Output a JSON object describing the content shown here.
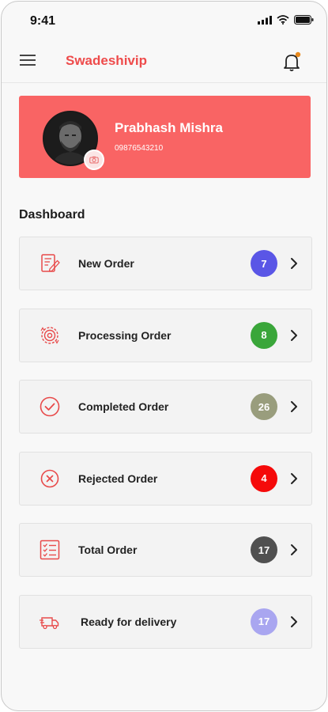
{
  "status_bar": {
    "time": "9:41"
  },
  "header": {
    "title": "Swadeshivip",
    "menu_icon": "hamburger-icon",
    "notification_icon": "bell-icon",
    "accent_color": "#ee4b4b"
  },
  "profile": {
    "name": "Prabhash Mishra",
    "phone": "09876543210",
    "card_color": "#f96464"
  },
  "dashboard": {
    "title": "Dashboard",
    "items": [
      {
        "label": "New Order",
        "count": "7",
        "badge_color": "#5a56e6",
        "icon": "edit-document-icon"
      },
      {
        "label": "Processing Order",
        "count": "8",
        "badge_color": "#3aa63a",
        "icon": "processing-gear-icon"
      },
      {
        "label": "Completed Order",
        "count": "26",
        "badge_color": "#999d7d",
        "icon": "check-circle-icon"
      },
      {
        "label": "Rejected Order",
        "count": "4",
        "badge_color": "#f50a0a",
        "icon": "x-circle-icon"
      },
      {
        "label": "Total Order",
        "count": "17",
        "badge_color": "#505050",
        "icon": "checklist-icon"
      },
      {
        "label": "Ready for delivery",
        "count": "17",
        "badge_color": "#a9a6f0",
        "icon": "delivery-truck-icon"
      }
    ]
  }
}
